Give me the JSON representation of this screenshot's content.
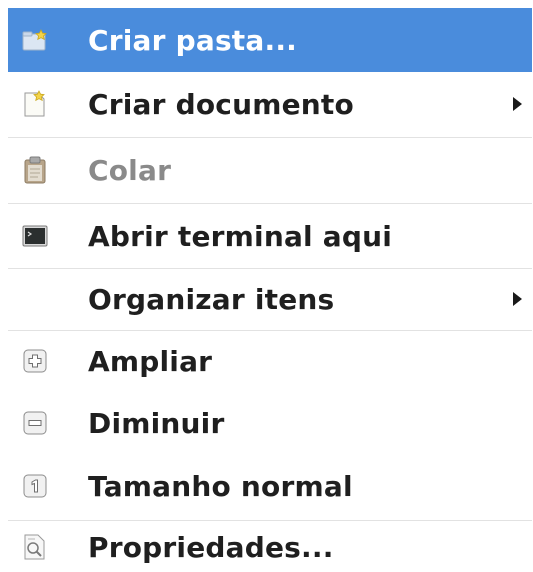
{
  "menu": {
    "items": [
      {
        "label": "Criar pasta...",
        "icon": "new-folder-icon",
        "state": "highlighted"
      },
      {
        "label": "Criar documento",
        "icon": "new-document-icon",
        "submenu": true
      },
      {
        "label": "Colar",
        "icon": "paste-icon",
        "state": "disabled"
      },
      {
        "label": "Abrir terminal aqui",
        "icon": "terminal-icon"
      },
      {
        "label": "Organizar itens",
        "icon": "",
        "submenu": true
      },
      {
        "label": "Ampliar",
        "icon": "zoom-in-icon"
      },
      {
        "label": "Diminuir",
        "icon": "zoom-out-icon"
      },
      {
        "label": "Tamanho normal",
        "icon": "zoom-normal-icon"
      },
      {
        "label": "Propriedades...",
        "icon": "properties-icon"
      }
    ]
  },
  "colors": {
    "highlight": "#4a8cdc",
    "text": "#1f1f1f",
    "disabled_text": "#8a8a8a",
    "separator": "#e2e2e2"
  }
}
